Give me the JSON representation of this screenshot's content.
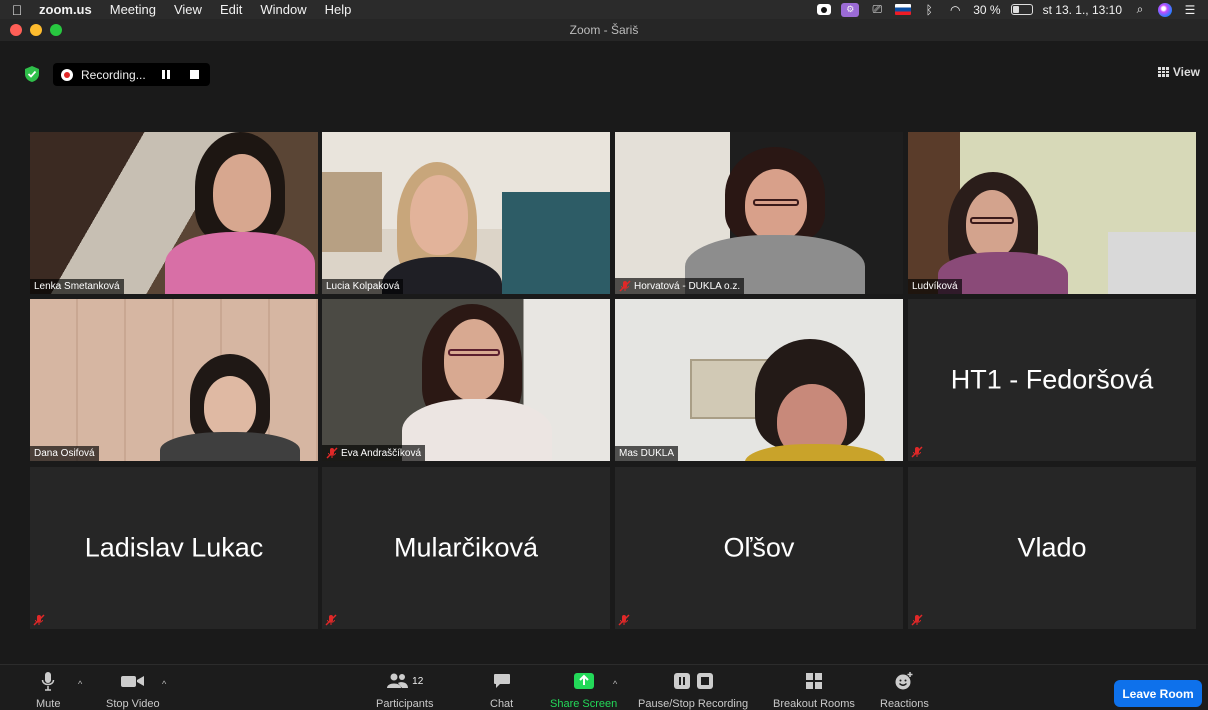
{
  "menubar": {
    "app": "zoom.us",
    "items": [
      "Meeting",
      "View",
      "Edit",
      "Window",
      "Help"
    ],
    "battery": "30 %",
    "datetime": "st 13. 1., 13:10"
  },
  "window": {
    "title": "Zoom - Šariš"
  },
  "recording": {
    "label": "Recording..."
  },
  "view_button": {
    "label": "View"
  },
  "participants": [
    {
      "name": "Lenka Smetanková",
      "video": true,
      "muted": false
    },
    {
      "name": "Lucia Kolpaková",
      "video": true,
      "muted": false
    },
    {
      "name": "Horvatová - DUKLA o.z.",
      "video": true,
      "muted": true
    },
    {
      "name": "Ludvíková",
      "video": true,
      "muted": false
    },
    {
      "name": "Dana Osifová",
      "video": true,
      "muted": false,
      "active_speaker": true
    },
    {
      "name": "Eva Andraščíková",
      "video": true,
      "muted": true
    },
    {
      "name": "Mas DUKLA",
      "video": true,
      "muted": false
    },
    {
      "name": "HT1 - Fedoršová",
      "video": false,
      "muted": true
    },
    {
      "name": "Ladislav Lukac",
      "video": false,
      "muted": true
    },
    {
      "name": "Mularčiková",
      "video": false,
      "muted": true
    },
    {
      "name": "Oľšov",
      "video": false,
      "muted": true
    },
    {
      "name": "Vlado",
      "video": false,
      "muted": true
    }
  ],
  "toolbar": {
    "mute": "Mute",
    "stop_video": "Stop Video",
    "participants": "Participants",
    "participant_count": "12",
    "chat": "Chat",
    "share_screen": "Share Screen",
    "pause_stop_recording": "Pause/Stop Recording",
    "breakout_rooms": "Breakout Rooms",
    "reactions": "Reactions",
    "leave": "Leave Room"
  },
  "colors": {
    "active_speaker_border": "#d4e27a",
    "leave_button": "#0e71eb",
    "share_screen": "#23d959",
    "recording_dot": "#e02828",
    "mute_icon": "#e02828"
  },
  "icons": {
    "security": "shield-icon",
    "recording": "record-dot-icon",
    "mute": "microphone-icon",
    "video": "video-camera-icon",
    "participants": "people-icon",
    "chat": "chat-bubble-icon",
    "share": "share-arrow-icon",
    "breakout": "grid-icon",
    "reactions": "smiley-plus-icon"
  }
}
